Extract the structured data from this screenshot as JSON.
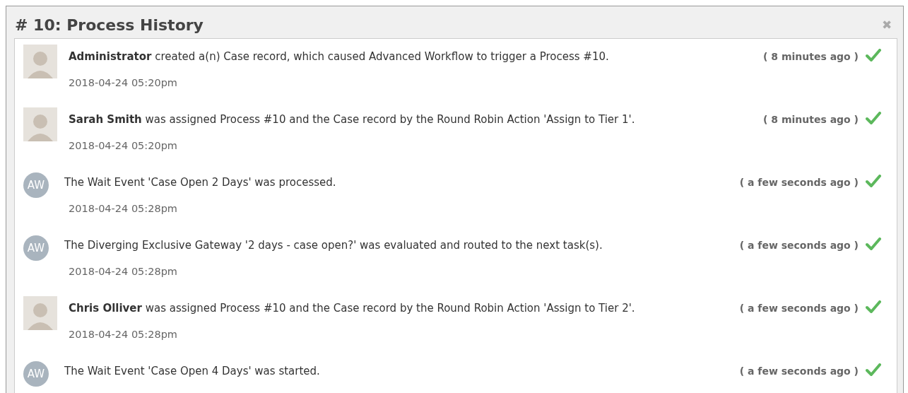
{
  "dialog": {
    "title": "# 10: Process History",
    "close": "✖"
  },
  "entries": [
    {
      "kind": "photo",
      "message": "**Administrator** created a(n)  Case record, which caused Advanced Workflow to trigger a Process #10.",
      "ago": "( 8 minutes ago )",
      "completed": true,
      "timestamp": "2018-04-24 05:20pm"
    },
    {
      "kind": "photo",
      "message": "**Sarah Smith** was assigned Process #10 and the  Case record by the Round Robin Action 'Assign to Tier 1'.",
      "ago": "( 8 minutes ago )",
      "completed": true,
      "timestamp": "2018-04-24 05:20pm"
    },
    {
      "kind": "initials",
      "initials": "AW",
      "message": "The Wait Event 'Case Open 2 Days' was processed.",
      "ago": "( a few seconds ago )",
      "completed": true,
      "timestamp": "2018-04-24 05:28pm"
    },
    {
      "kind": "initials",
      "initials": "AW",
      "message": "The Diverging Exclusive Gateway '2 days - case open?' was evaluated and routed to the next task(s).",
      "ago": "( a few seconds ago )",
      "completed": true,
      "timestamp": "2018-04-24 05:28pm"
    },
    {
      "kind": "photo",
      "message": "**Chris Olliver** was assigned Process #10 and the  Case record by the Round Robin Action 'Assign to Tier 2'.",
      "ago": "( a few seconds ago )",
      "completed": true,
      "timestamp": "2018-04-24 05:28pm"
    },
    {
      "kind": "initials",
      "initials": "AW",
      "message": "The Wait Event 'Case Open 4 Days' was started.",
      "ago": "( a few seconds ago )",
      "completed": true
    }
  ]
}
